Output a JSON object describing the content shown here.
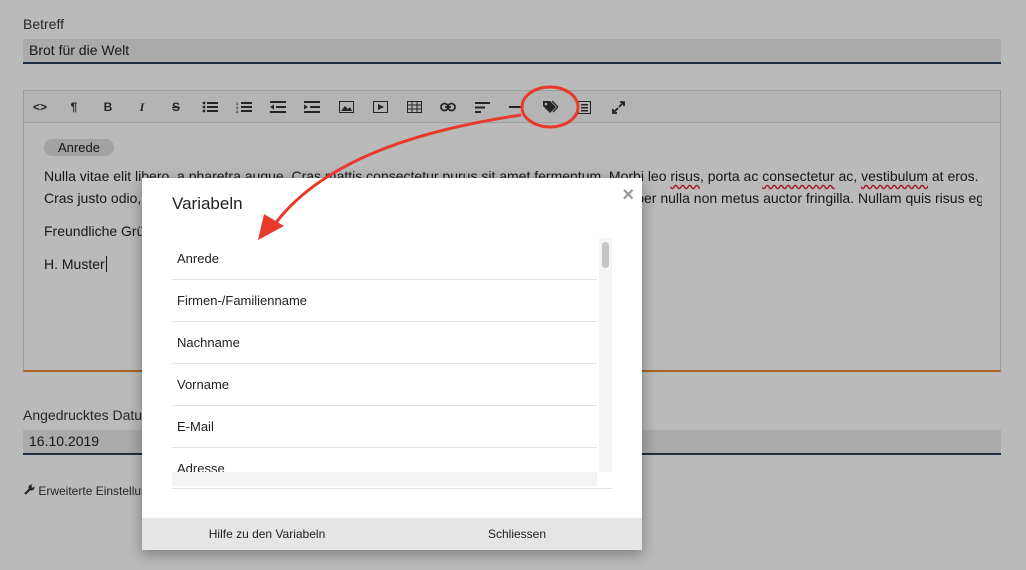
{
  "form": {
    "subject_label": "Betreff",
    "subject_value": "Brot für die Welt",
    "date_label": "Angedrucktes Datum",
    "date_value": "16.10.2019",
    "advanced_label": "Erweiterte Einstellungen"
  },
  "toolbar": {
    "buttons": [
      "<>",
      "¶",
      "B",
      "I",
      "S"
    ]
  },
  "editor": {
    "tag_pill": "Anrede",
    "para1_start": "Nulla vitae elit libero, a pharetra augue. Cras mattis consectetur purus sit amet fermentum. Morbi leo ",
    "word_risus": "risus",
    "para1_mid": ", porta ac ",
    "word_consectetur": "consectetur",
    "para1_mid2": " ac, ",
    "word_vestibulum": "vestibulum",
    "para1_end": " at eros.",
    "para2": "Cras justo odio, dapibus ac facilisis in, egestas eget quam. Donec sed odio dui. Donec ullamcorper nulla non metus auctor fringilla. Nullam quis risus eget urna mollis ornare vel eu leo.",
    "greeting": "Freundliche Grüsse",
    "signature": "H. Muster"
  },
  "modal": {
    "title": "Variabeln",
    "close_symbol": "×",
    "items": [
      "Anrede",
      "Firmen-/Familienname",
      "Nachname",
      "Vorname",
      "E-Mail",
      "Adresse"
    ],
    "help_button": "Hilfe zu den Variabeln",
    "close_button": "Schliessen"
  },
  "colors": {
    "annotation_red": "#e8392a",
    "editor_accent": "#e58a2e",
    "input_underline": "#2b3e57"
  }
}
